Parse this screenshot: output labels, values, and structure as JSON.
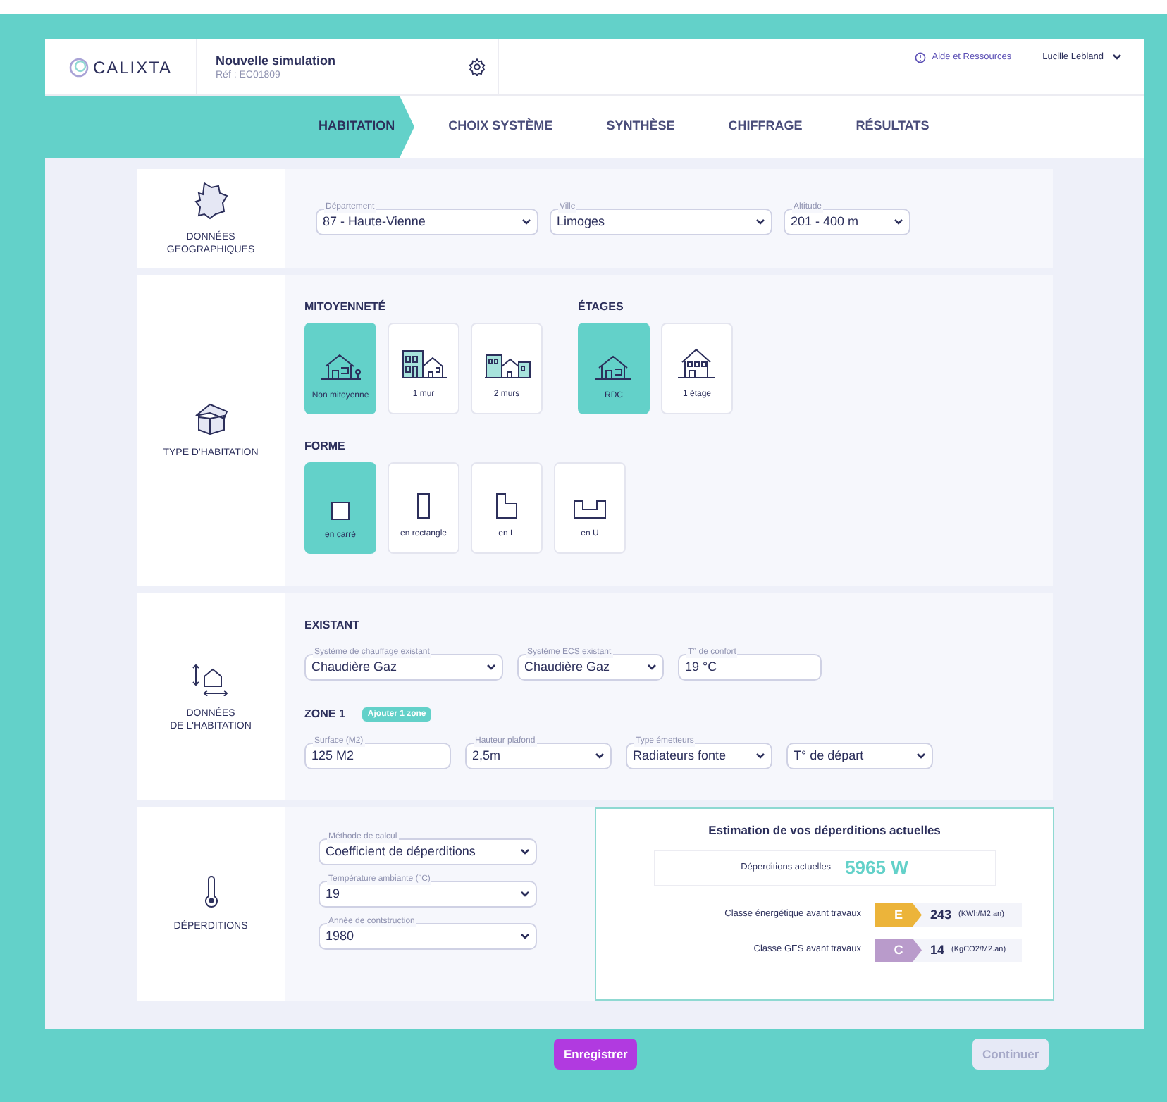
{
  "header": {
    "logo": "CALIXTA",
    "title": "Nouvelle simulation",
    "reference": "Réf : EC01809",
    "help": "Aide et Ressources",
    "user": "Lucille Lebland"
  },
  "steps": [
    {
      "label": "HABITATION",
      "selected": true
    },
    {
      "label": "CHOIX SYSTÈME",
      "selected": false
    },
    {
      "label": "SYNTHÈSE",
      "selected": false
    },
    {
      "label": "CHIFFRAGE",
      "selected": false
    },
    {
      "label": "RÉSULTATS",
      "selected": false
    }
  ],
  "geo": {
    "title": "DONNÉES GEOGRAPHIQUES",
    "fields": [
      {
        "label": "Département",
        "value": "87 - Haute-Vienne",
        "kind": "select"
      },
      {
        "label": "Ville",
        "value": "Limoges",
        "kind": "select"
      },
      {
        "label": "Altitude",
        "value": "201 - 400 m",
        "kind": "select"
      }
    ]
  },
  "type": {
    "title": "TYPE D'HABITATION",
    "groups": [
      {
        "title": "MITOYENNETÉ",
        "options": [
          {
            "label": "Non mitoyenne",
            "selected": true,
            "kind": "house"
          },
          {
            "label": "1 mur",
            "selected": false,
            "kind": "one-wall"
          },
          {
            "label": "2 murs",
            "selected": false,
            "kind": "two-walls"
          }
        ]
      },
      {
        "title": "ÉTAGES",
        "options": [
          {
            "label": "RDC",
            "selected": true,
            "kind": "ground"
          },
          {
            "label": "1 étage",
            "selected": false,
            "kind": "storey"
          }
        ]
      },
      {
        "title": "FORME",
        "options": [
          {
            "label": "en carré",
            "selected": true,
            "kind": "square"
          },
          {
            "label": "en rectangle",
            "selected": false,
            "kind": "rectangle"
          },
          {
            "label": "en L",
            "selected": false,
            "kind": "l-shape"
          },
          {
            "label": "en U",
            "selected": false,
            "kind": "u-shape"
          }
        ]
      }
    ]
  },
  "habitation": {
    "title_1": "DONNÉES",
    "title_2": "DE L'HABITATION",
    "existing": {
      "title": "EXISTANT",
      "fields": [
        {
          "label": "Système de chauffage existant",
          "value": "Chaudière Gaz",
          "kind": "select"
        },
        {
          "label": "Système ECS existant",
          "value": "Chaudière Gaz",
          "kind": "select"
        },
        {
          "label": "T° de confort",
          "value": "19 °C",
          "kind": "input"
        }
      ]
    },
    "zone": {
      "title": "ZONE 1",
      "add_button": "Ajouter 1 zone",
      "fields": [
        {
          "label": "Surface (M2)",
          "value": "125 M2",
          "kind": "input"
        },
        {
          "label": "Hauteur plafond",
          "value": "2,5m",
          "kind": "select"
        },
        {
          "label": "Type émetteurs",
          "value": "Radiateurs fonte",
          "kind": "select"
        },
        {
          "value": "T° de départ",
          "kind": "select"
        }
      ]
    }
  },
  "losses": {
    "title": "DÉPERDITIONS",
    "fields": [
      {
        "label": "Méthode de calcul",
        "value": "Coefficient de déperditions",
        "kind": "select"
      },
      {
        "label": "Température ambiante (°C)",
        "value": "19",
        "kind": "select"
      },
      {
        "label": "Année de contstruction",
        "value": "1980",
        "kind": "select"
      }
    ],
    "estimate": {
      "title": "Estimation de vos déperditions actuelles",
      "current_label": "Déperditions actuelles",
      "current_value": "5965 W",
      "classes": [
        {
          "label": "Classe énergétique avant travaux",
          "grade": "E",
          "color": "#ecb43a",
          "value": "243",
          "unit": "(KWh/M2.an)"
        },
        {
          "label": "Classe GES avant travaux",
          "grade": "C",
          "color": "#b99bcb",
          "value": "14",
          "unit": "(KgCO2/M2.an)"
        }
      ]
    }
  },
  "footer": {
    "save": "Enregistrer",
    "continue": "Continuer",
    "continue_disabled": true
  }
}
